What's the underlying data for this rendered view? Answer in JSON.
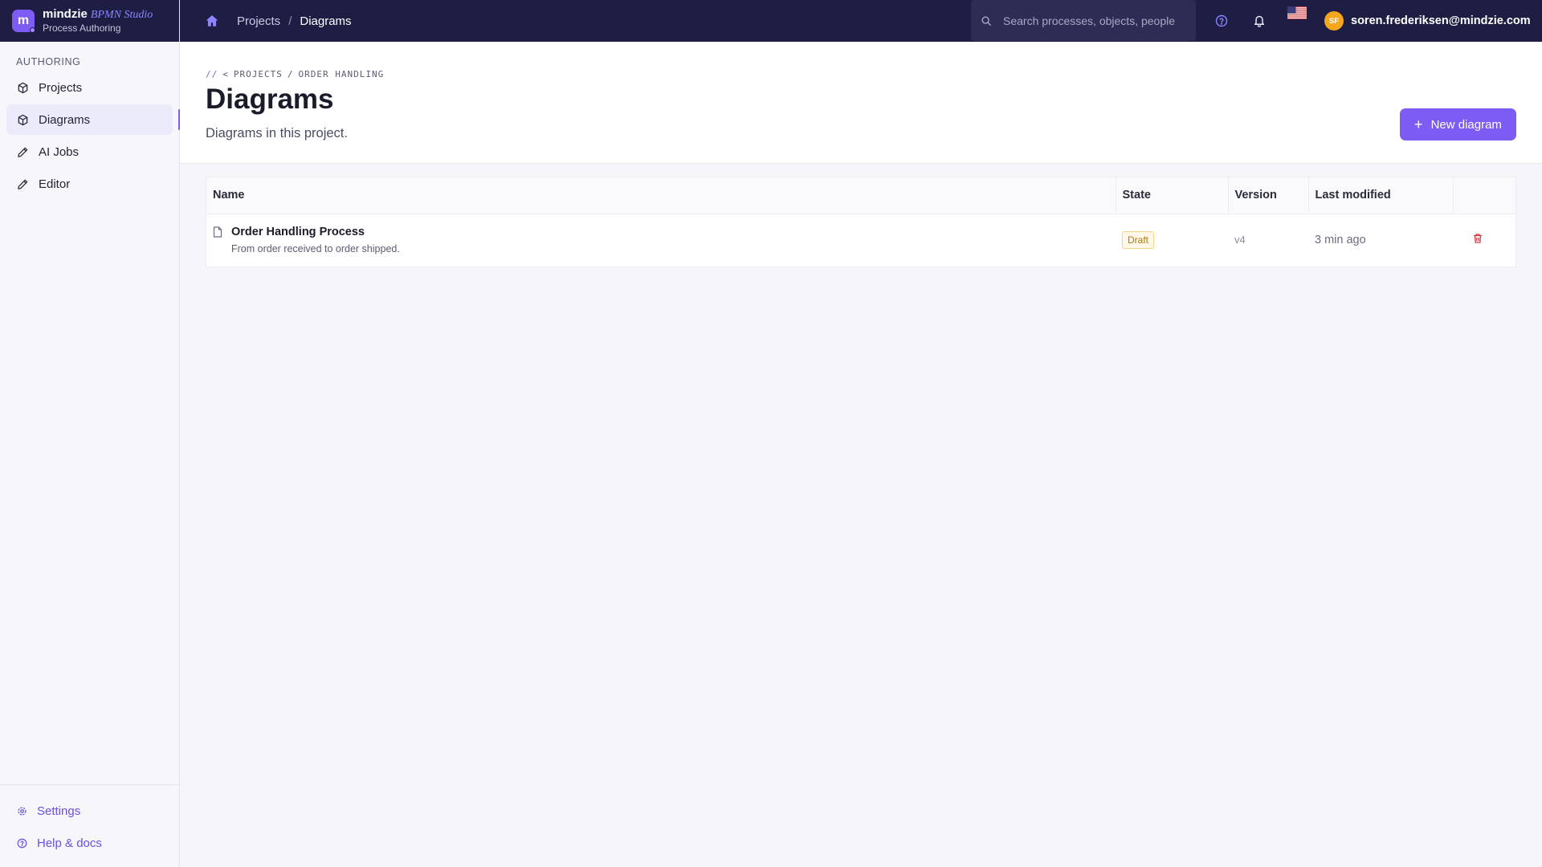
{
  "brand": {
    "logo_letter": "m",
    "name": "mindzie",
    "studio": "BPMN Studio",
    "subtitle": "Process Authoring"
  },
  "sidebar": {
    "section_label": "AUTHORING",
    "items": [
      {
        "label": "Projects",
        "icon": "cube-icon",
        "active": false
      },
      {
        "label": "Diagrams",
        "icon": "cube-icon",
        "active": true
      },
      {
        "label": "AI Jobs",
        "icon": "pencil-icon",
        "active": false
      },
      {
        "label": "Editor",
        "icon": "pencil-icon",
        "active": false
      }
    ],
    "bottom": [
      {
        "label": "Settings",
        "icon": "gear-icon"
      },
      {
        "label": "Help & docs",
        "icon": "help-circle-icon"
      }
    ]
  },
  "topbar": {
    "breadcrumb": [
      "Projects",
      "Diagrams"
    ],
    "breadcrumb_sep": "/",
    "search_placeholder": "Search processes, objects, people",
    "user_initials": "SF",
    "user_email": "soren.frederiksen@mindzie.com"
  },
  "page": {
    "path_slashes": "//",
    "path_back": "<",
    "path": [
      "PROJECTS",
      "ORDER HANDLING"
    ],
    "path_sep": "/",
    "title": "Diagrams",
    "subtitle": "Diagrams in this project.",
    "new_button_label": "New diagram"
  },
  "table": {
    "columns": [
      "Name",
      "State",
      "Version",
      "Last modified"
    ],
    "rows": [
      {
        "name": "Order Handling Process",
        "description": "From order received to order shipped.",
        "state": "Draft",
        "version": "v4",
        "modified": "3 min ago"
      }
    ]
  },
  "colors": {
    "accent": "#7c5cf5",
    "topbar": "#1e1e45",
    "draft_badge": "#b07a12",
    "delete": "#d9363e"
  }
}
